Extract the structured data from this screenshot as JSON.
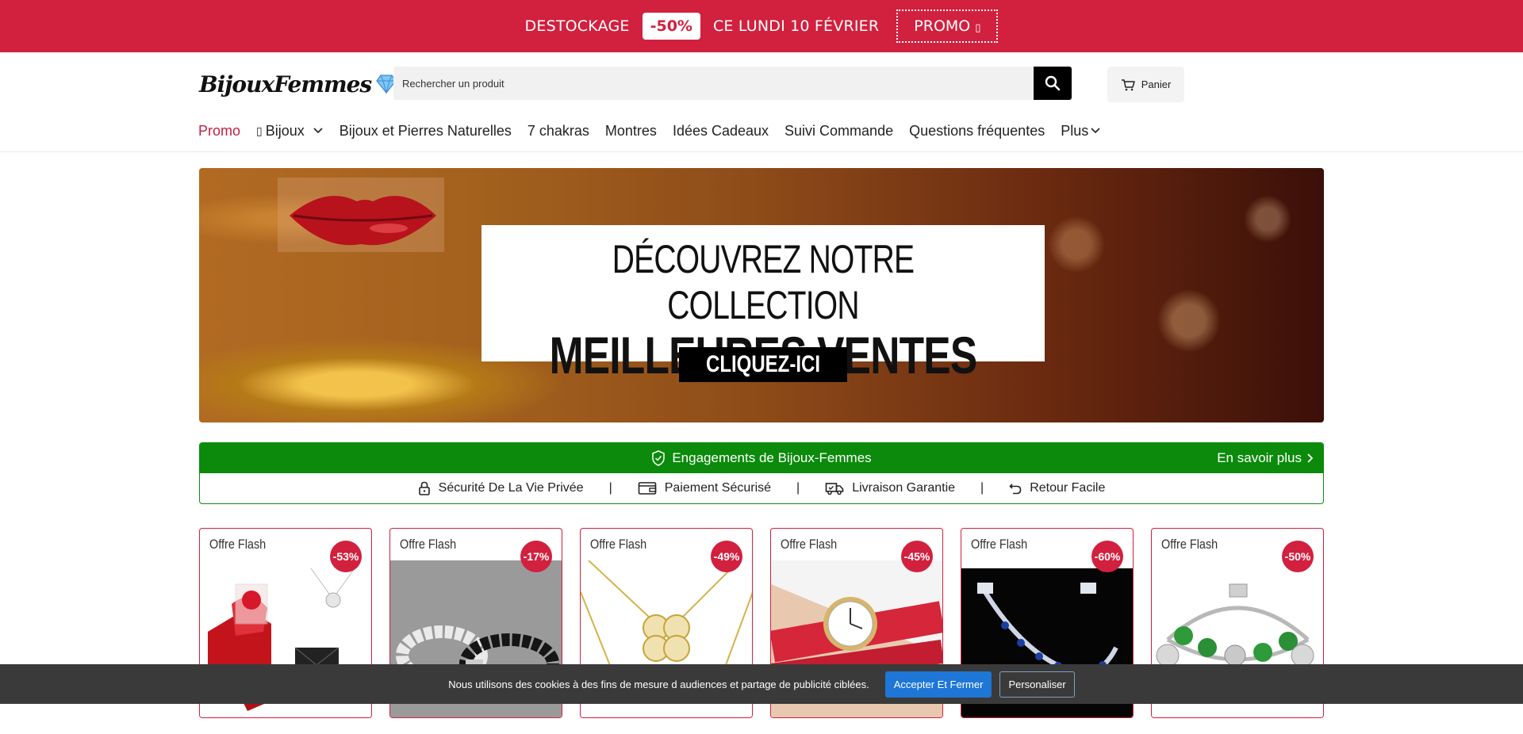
{
  "topbar": {
    "text_before": "DESTOCKAGE",
    "discount": "-50%",
    "text_after": "CE LUNDI 10 FÉVRIER",
    "promo_button": "PROMO",
    "background": "#d2203f"
  },
  "header": {
    "logo_text": "BijouxFemmes",
    "search": {
      "placeholder": "Rechercher un produit"
    },
    "cart_label": "Panier"
  },
  "nav": {
    "items": [
      {
        "label": "Promo",
        "active": true
      },
      {
        "label": "Bijoux",
        "dropdown": true
      },
      {
        "label": "Bijoux et Pierres Naturelles"
      },
      {
        "label": "7 chakras"
      },
      {
        "label": "Montres"
      },
      {
        "label": "Idées Cadeaux"
      },
      {
        "label": "Suivi Commande"
      },
      {
        "label": "Questions fréquentes"
      },
      {
        "label": "Plus",
        "dropdown": true
      }
    ]
  },
  "hero": {
    "line1": "DÉCOUVREZ NOTRE COLLECTION",
    "line2": "MEILLEURES VENTES",
    "cta": "CLIQUEZ-ICI"
  },
  "engagements": {
    "title": "Engagements de Bijoux-Femmes",
    "link": "En savoir plus",
    "accent": "#0b8a0b",
    "items": [
      {
        "label": "Sécurité De La Vie Privée",
        "icon": "lock-icon"
      },
      {
        "label": "Paiement Sécurisé",
        "icon": "wallet-icon"
      },
      {
        "label": "Livraison Garantie",
        "icon": "truck-icon"
      },
      {
        "label": "Retour Facile",
        "icon": "return-icon"
      }
    ],
    "separator": "|"
  },
  "products": [
    {
      "tag": "Offre Flash",
      "discount": "-53%",
      "image": "rose-box-necklace"
    },
    {
      "tag": "Offre Flash",
      "discount": "-17%",
      "image": "bead-bracelets"
    },
    {
      "tag": "Offre Flash",
      "discount": "-49%",
      "image": "heart-clover-pendant"
    },
    {
      "tag": "Offre Flash",
      "discount": "-45%",
      "image": "red-wrap-watch"
    },
    {
      "tag": "Offre Flash",
      "discount": "-60%",
      "image": "blue-crystal-bracelet"
    },
    {
      "tag": "Offre Flash",
      "discount": "-50%",
      "image": "green-charm-bracelet"
    }
  ],
  "cookie": {
    "message": "Nous utilisons des cookies à des fins de mesure d audiences et partage de publicité ciblées.",
    "accept": "Accepter Et Fermer",
    "customize": "Personaliser"
  }
}
